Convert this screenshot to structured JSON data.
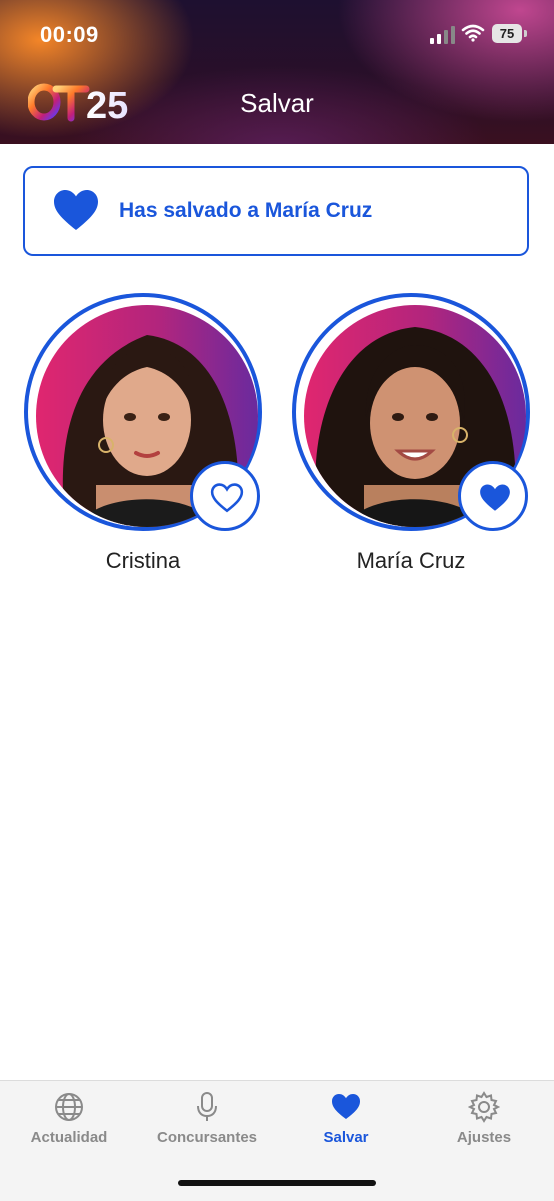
{
  "status_bar": {
    "time": "00:09",
    "battery": "75"
  },
  "header": {
    "logo_text": "OT25",
    "title": "Salvar"
  },
  "banner": {
    "text": "Has salvado a María Cruz",
    "icon": "heart-filled-icon"
  },
  "contestants": [
    {
      "name": "Cristina",
      "saved": false,
      "icon": "heart-outline-icon"
    },
    {
      "name": "María Cruz",
      "saved": true,
      "icon": "heart-filled-icon"
    }
  ],
  "tabs": [
    {
      "label": "Actualidad",
      "icon": "globe-icon",
      "active": false
    },
    {
      "label": "Concursantes",
      "icon": "microphone-icon",
      "active": false
    },
    {
      "label": "Salvar",
      "icon": "heart-icon",
      "active": true
    },
    {
      "label": "Ajustes",
      "icon": "gear-icon",
      "active": false
    }
  ],
  "colors": {
    "accent": "#1a56db",
    "inactive": "#8a8a8a"
  }
}
